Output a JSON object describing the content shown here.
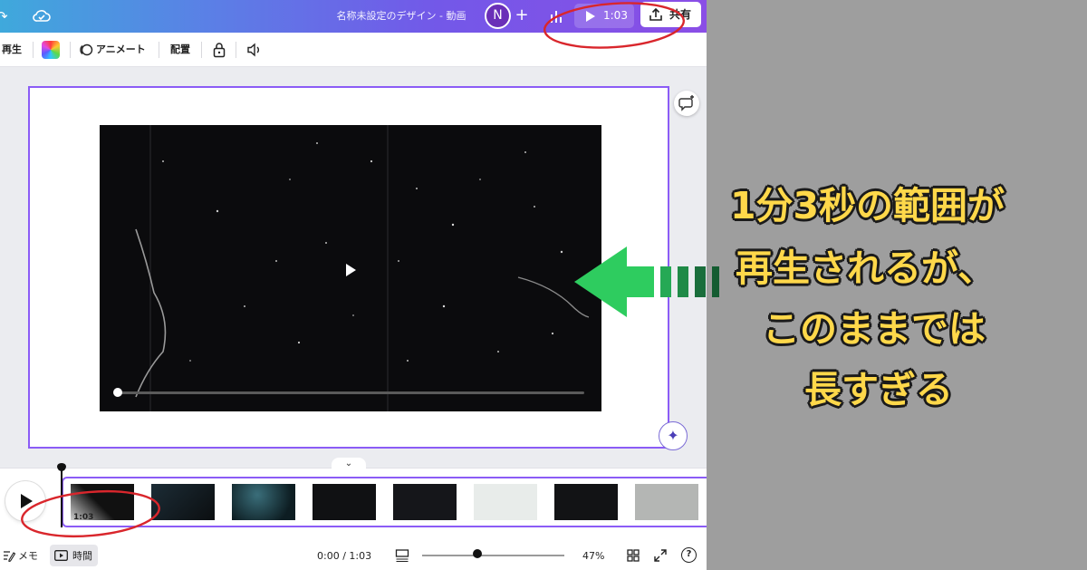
{
  "window": {
    "title": "名称未設定のデザイン - 動画",
    "avatar_initial": "N"
  },
  "header": {
    "present_label": "1:03",
    "share_label": "共有"
  },
  "toolbar": {
    "playback_label": "再生",
    "animate_label": "アニメート",
    "position_label": "配置"
  },
  "timeline": {
    "clip_duration": "1:03",
    "thumbnail_count": 8
  },
  "bottombar": {
    "notes_label": "メモ",
    "time_label": "時間",
    "time_readout": "0:00 / 1:03",
    "zoom_label": "47%",
    "help_label": "?"
  },
  "annotation": {
    "lines": [
      "1分3秒の範囲が",
      "再生されるが、",
      "このままでは",
      "長すぎる"
    ],
    "text_color": "#ffd84a",
    "arrow_color": "#2ecc5f",
    "circle_color": "#d9262c"
  },
  "colors": {
    "selection": "#8b5cf6",
    "topbar_gradient_start": "#3fa9dc",
    "topbar_gradient_end": "#8a4ee6"
  }
}
